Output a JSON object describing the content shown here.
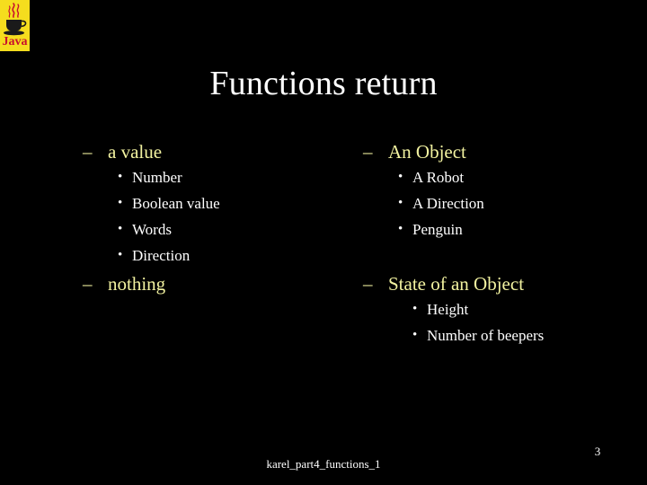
{
  "slide": {
    "title": "Functions return",
    "background_color": "#000000",
    "title_color": "#FFFFFF",
    "heading_color": "#F2F2A0",
    "body_color": "#FFFFFF",
    "footer": "karel_part4_functions_1",
    "page_number": "3"
  },
  "logo": {
    "name": "java-logo",
    "wordmark": "Java",
    "background_color": "#F5DD1E",
    "text_color": "#C8102E"
  },
  "markers": {
    "dash": "–",
    "bullet": "•"
  },
  "columns": {
    "left": [
      {
        "heading": "a value",
        "items": [
          "Number",
          "Boolean value",
          "Words",
          "Direction"
        ]
      },
      {
        "heading": "nothing",
        "items": []
      }
    ],
    "right": [
      {
        "heading": "An Object",
        "items": [
          "A Robot",
          "A Direction",
          "Penguin"
        ]
      },
      {
        "heading": "State of an Object",
        "items": [
          "Height",
          "Number of beepers"
        ]
      }
    ]
  }
}
